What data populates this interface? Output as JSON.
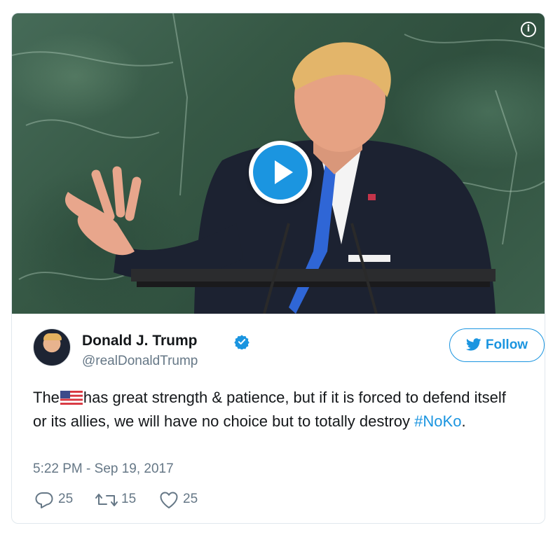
{
  "media": {
    "type": "video",
    "info_icon": "info-icon",
    "play_icon": "play-icon"
  },
  "tweet": {
    "user_name": "Donald J. Trump",
    "user_handle": "@realDonaldTrump",
    "verified": true,
    "follow_label": "Follow",
    "text_before_flag": "The",
    "flag_emoji": "🇺🇸",
    "text_after_flag": "has great strength & patience, but if it is forced to defend itself or its allies, we will have no choice but to totally destroy ",
    "hashtag": "#NoKo",
    "text_end": ".",
    "timestamp": "5:22 PM - Sep 19, 2017",
    "replies": "25",
    "retweets": "15",
    "likes": "25"
  },
  "colors": {
    "accent": "#1b95e0",
    "secondary_text": "#657786",
    "border": "#e1e8ed"
  }
}
